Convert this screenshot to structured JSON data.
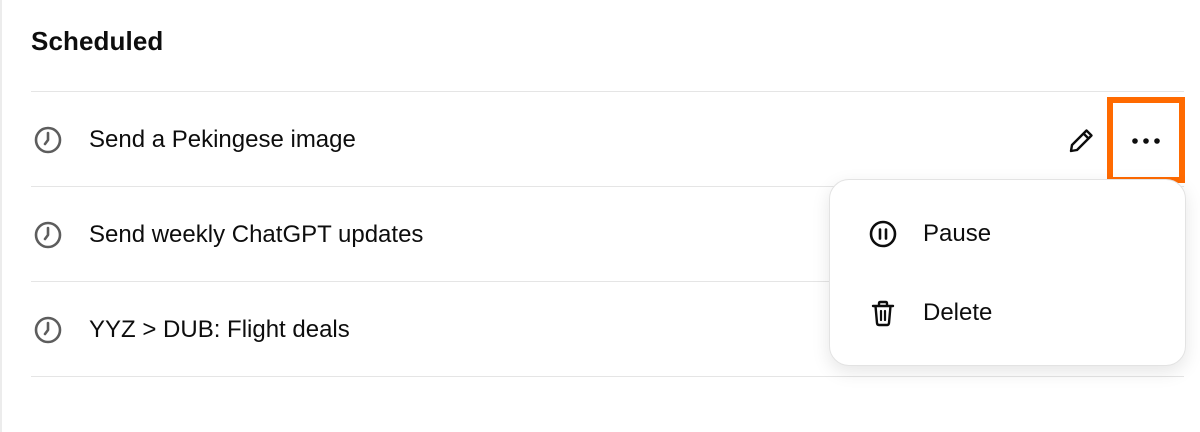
{
  "section": {
    "title": "Scheduled"
  },
  "tasks": [
    {
      "label": "Send a Pekingese image",
      "icon": "clock-icon"
    },
    {
      "label": "Send weekly ChatGPT updates",
      "icon": "clock-icon"
    },
    {
      "label": "YYZ > DUB: Flight deals",
      "icon": "clock-icon"
    }
  ],
  "row_actions": {
    "edit_icon": "pencil-icon",
    "more_icon": "more-horizontal-icon",
    "highlight_color": "#ff6a00"
  },
  "context_menu": {
    "items": [
      {
        "label": "Pause",
        "icon": "pause-circle-icon"
      },
      {
        "label": "Delete",
        "icon": "trash-icon"
      }
    ]
  }
}
